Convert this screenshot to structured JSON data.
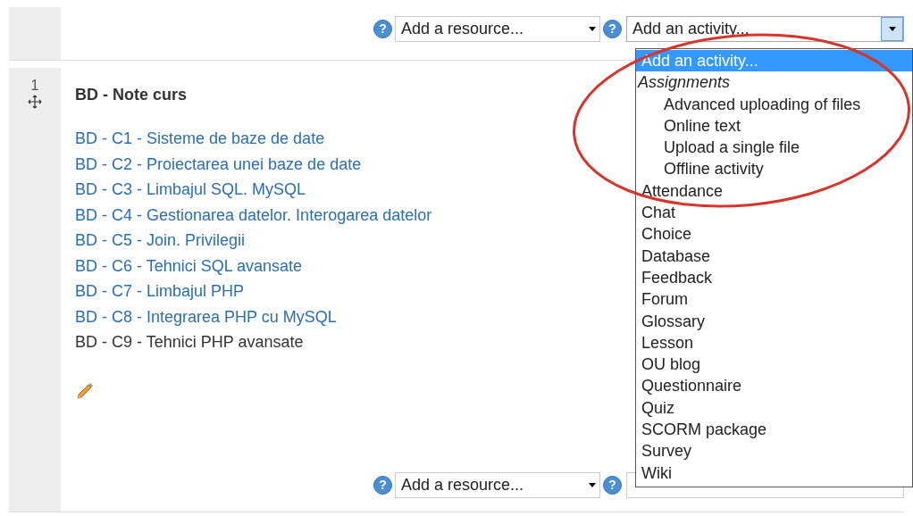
{
  "top_bar": {
    "resource_select": {
      "help": "?",
      "value": "Add a resource..."
    },
    "activity_select": {
      "help": "?",
      "value": "Add an activity...",
      "expanded": true
    }
  },
  "activity_dropdown": {
    "options": [
      {
        "label": "Add an activity...",
        "kind": "option",
        "selected": true
      },
      {
        "label": "Assignments",
        "kind": "group",
        "selected": false
      },
      {
        "label": "Advanced uploading of files",
        "kind": "sub",
        "selected": false
      },
      {
        "label": "Online text",
        "kind": "sub",
        "selected": false
      },
      {
        "label": "Upload a single file",
        "kind": "sub",
        "selected": false
      },
      {
        "label": "Offline activity",
        "kind": "sub",
        "selected": false
      },
      {
        "label": "Attendance",
        "kind": "option",
        "selected": false
      },
      {
        "label": "Chat",
        "kind": "option",
        "selected": false
      },
      {
        "label": "Choice",
        "kind": "option",
        "selected": false
      },
      {
        "label": "Database",
        "kind": "option",
        "selected": false
      },
      {
        "label": "Feedback",
        "kind": "option",
        "selected": false
      },
      {
        "label": "Forum",
        "kind": "option",
        "selected": false
      },
      {
        "label": "Glossary",
        "kind": "option",
        "selected": false
      },
      {
        "label": "Lesson",
        "kind": "option",
        "selected": false
      },
      {
        "label": "OU blog",
        "kind": "option",
        "selected": false
      },
      {
        "label": "Questionnaire",
        "kind": "option",
        "selected": false
      },
      {
        "label": "Quiz",
        "kind": "option",
        "selected": false
      },
      {
        "label": "SCORM package",
        "kind": "option",
        "selected": false
      },
      {
        "label": "Survey",
        "kind": "option",
        "selected": false
      },
      {
        "label": "Wiki",
        "kind": "option",
        "selected": false
      }
    ]
  },
  "section": {
    "number": "1",
    "title": "BD - Note curs",
    "items": [
      {
        "label": "BD - C1 - Sisteme de baze de date",
        "linked": true
      },
      {
        "label": "BD - C2 - Proiectarea unei baze de date",
        "linked": true
      },
      {
        "label": "BD - C3 - Limbajul SQL. MySQL",
        "linked": true
      },
      {
        "label": "BD - C4 - Gestionarea datelor. Interogarea datelor",
        "linked": true
      },
      {
        "label": "BD - C5 - Join. Privilegii",
        "linked": true
      },
      {
        "label": "BD - C6 - Tehnici SQL avansate",
        "linked": true
      },
      {
        "label": "BD - C7 - Limbajul PHP",
        "linked": true
      },
      {
        "label": "BD - C8 - Integrarea PHP cu MySQL",
        "linked": true
      },
      {
        "label": "BD - C9 - Tehnici PHP avansate",
        "linked": false
      }
    ]
  },
  "bottom_bar": {
    "resource_select": {
      "help": "?",
      "value": "Add a resource..."
    },
    "activity_help": "?"
  }
}
